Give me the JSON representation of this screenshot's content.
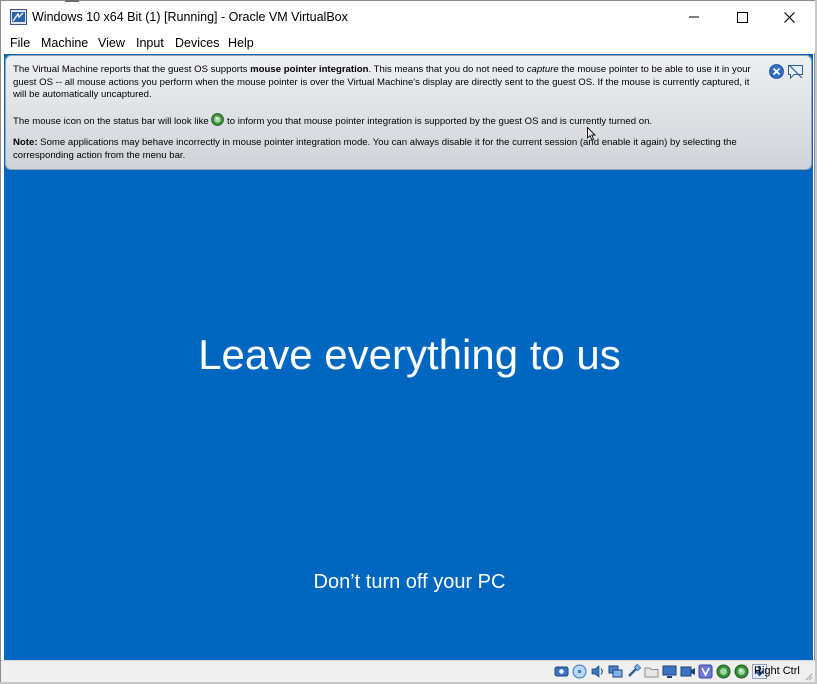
{
  "window": {
    "title": "Windows 10 x64 Bit (1) [Running] - Oracle VM VirtualBox",
    "icon": "virtualbox-icon",
    "controls": [
      "minimize-icon",
      "maximize-icon",
      "close-icon"
    ]
  },
  "menu": {
    "items": [
      "File",
      "Machine",
      "View",
      "Input",
      "Devices",
      "Help"
    ]
  },
  "banner": {
    "p1_before": "The Virtual Machine reports that the guest OS supports ",
    "p1_bold": "mouse pointer integration",
    "p1_middle": ". This means that you do not need to ",
    "p1_italic": "capture",
    "p1_after": " the mouse pointer to be able to use it in your guest OS -- all mouse actions you perform when the mouse pointer is over the Virtual Machine's display are directly sent to the guest OS. If the mouse is currently captured, it will be automatically uncaptured.",
    "p2_before": "The mouse icon on the status bar will look like ",
    "p2_after": " to inform you that mouse pointer integration is supported by the guest OS and is currently turned on.",
    "p3_bold": "Note:",
    "p3_text": " Some applications may behave incorrectly in mouse pointer integration mode. You can always disable it for the current session (and enable it again) by selecting the corresponding action from the menu bar.",
    "close_icon": "close-icon",
    "dismiss_icon": "dont-show-again-icon"
  },
  "vm_screen": {
    "headline": "Leave everything to us",
    "subline": "Don’t turn off your PC",
    "background": "#0067c0"
  },
  "status_bar": {
    "icons": [
      "hard-disk-icon",
      "optical-drive-icon",
      "audio-icon",
      "network-icon",
      "usb-icon",
      "shared-folders-icon",
      "display-icon",
      "video-capture-icon",
      "vrde-icon",
      "cpu-icon",
      "mouse-integration-icon",
      "keyboard-capture-icon"
    ],
    "host_key": "Right Ctrl"
  }
}
